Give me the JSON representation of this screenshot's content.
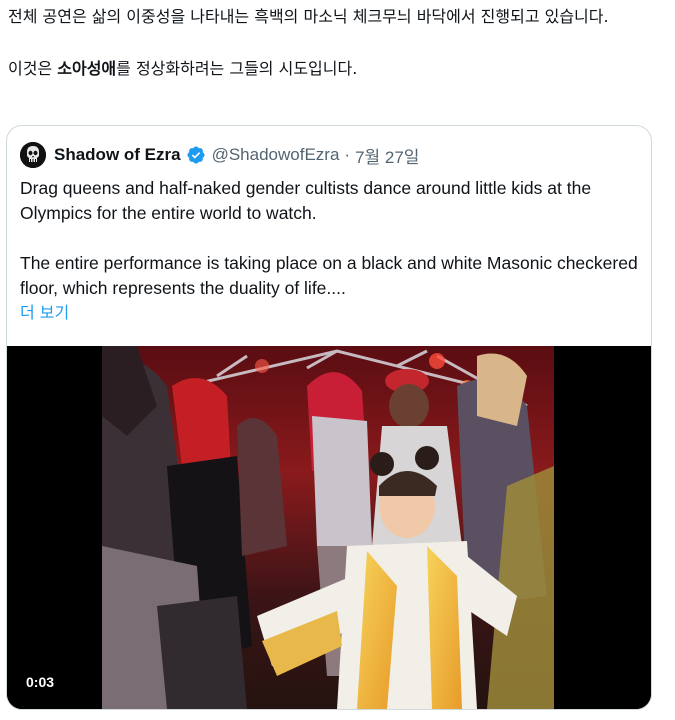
{
  "tweet": {
    "line1": "전체 공연은 삶의 이중성을 나타내는 흑백의 마소닉 체크무늬 바닥에서 진행되고 있습니다.",
    "line2_before": "이것은 ",
    "line2_bold": "소아성애",
    "line2_after": "를 정상화하려는 그들의 시도입니다."
  },
  "quote": {
    "name": "Shadow of Ezra",
    "handle": "@ShadowofEzra",
    "separator": "·",
    "date": "7월 27일",
    "paragraph1": "Drag queens and half-naked gender cultists dance around little kids at the Olympics for the entire world to watch.",
    "paragraph2": "The entire performance is taking place on a black and white Masonic checkered floor, which represents the duality of life....",
    "show_more": "더 보기",
    "avatar_icon": "skull-icon",
    "verified_icon": "verified-badge-icon",
    "verified_color": "#1d9bf0"
  },
  "video": {
    "timestamp": "0:03"
  }
}
